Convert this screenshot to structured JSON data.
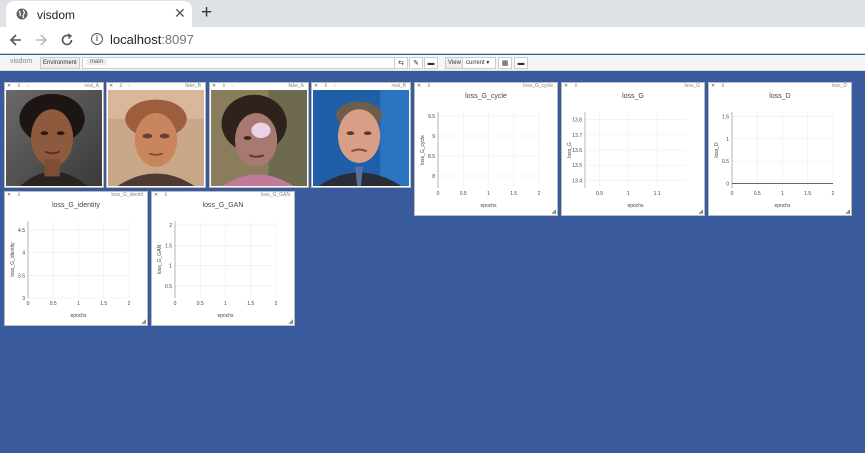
{
  "browser": {
    "tab_title": "visdom",
    "close_glyph": "✕",
    "new_tab_glyph": "+",
    "url_host": "localhost",
    "url_port": ":8097",
    "icons": [
      "globe-icon",
      "back-icon",
      "forward-icon",
      "reload-icon",
      "info-icon"
    ]
  },
  "toolbar": {
    "logo": "visdom",
    "environment_label": "Environment",
    "environment_value": "main",
    "view_label": "View",
    "view_value": "current ▾"
  },
  "panes": {
    "real_a": {
      "name": "real_A"
    },
    "fake_b": {
      "name": "fake_B"
    },
    "fake_a": {
      "name": "fake_A"
    },
    "real_b": {
      "name": "real_B"
    }
  },
  "chart_data": [
    {
      "type": "line",
      "title": "loss_G_cycle",
      "xlabel": "epochs",
      "ylabel": "loss_G_cycle",
      "pane_name": "loss_G_cycle",
      "xticks": [
        "0",
        "0.5",
        "1",
        "1.5",
        "2"
      ],
      "yticks": [
        "9.5",
        "9",
        "8.5",
        "8"
      ],
      "xlim": [
        0,
        2
      ],
      "ylim": [
        7.7,
        9.6
      ],
      "series": []
    },
    {
      "type": "line",
      "title": "loss_G",
      "xlabel": "epochs",
      "ylabel": "loss_G",
      "pane_name": "loss_G",
      "xticks": [
        "0.9",
        "1",
        "1.1"
      ],
      "yticks": [
        "13.8",
        "13.7",
        "13.6",
        "13.5",
        "13.4"
      ],
      "xlim": [
        0.85,
        1.2
      ],
      "ylim": [
        13.35,
        13.85
      ],
      "series": []
    },
    {
      "type": "line",
      "title": "loss_D",
      "xlabel": "epochs",
      "ylabel": "loss_D",
      "pane_name": "loss_D",
      "xticks": [
        "0",
        "0.5",
        "1",
        "1.5",
        "2"
      ],
      "yticks": [
        "1.5",
        "1",
        "0.5",
        "0"
      ],
      "xlim": [
        0,
        2
      ],
      "ylim": [
        -0.1,
        1.6
      ],
      "series": [
        {
          "x": [
            0,
            2
          ],
          "y": [
            0,
            0
          ]
        }
      ]
    },
    {
      "type": "line",
      "title": "loss_G_identity",
      "xlabel": "epochs",
      "ylabel": "loss_G_identity",
      "pane_name": "loss_G_identit",
      "xticks": [
        "0",
        "0.5",
        "1",
        "1.5",
        "2"
      ],
      "yticks": [
        "4.5",
        "4",
        "3.5",
        "3"
      ],
      "xlim": [
        0,
        2
      ],
      "ylim": [
        3,
        4.7
      ],
      "series": []
    },
    {
      "type": "line",
      "title": "loss_G_GAN",
      "xlabel": "epochs",
      "ylabel": "loss_G_GAN",
      "pane_name": "loss_G_GAN",
      "xticks": [
        "0",
        "0.5",
        "1",
        "1.5",
        "2"
      ],
      "yticks": [
        "2",
        "1.5",
        "1",
        "0.5"
      ],
      "xlim": [
        0,
        2
      ],
      "ylim": [
        0.2,
        2.1
      ],
      "series": []
    }
  ]
}
